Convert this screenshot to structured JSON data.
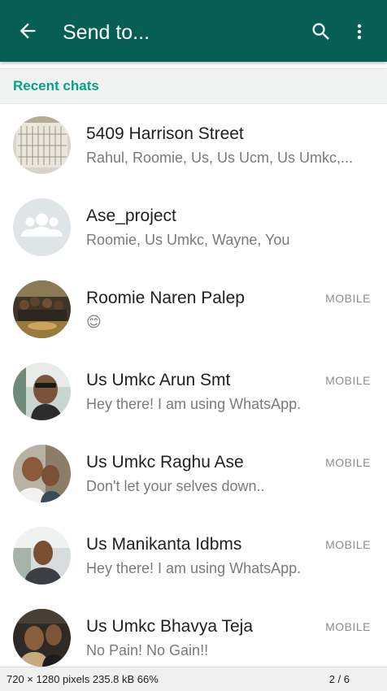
{
  "appbar": {
    "title": "Send to...",
    "color": "#075e54"
  },
  "section": {
    "label": "Recent chats",
    "color": "#07a187"
  },
  "chats": [
    {
      "name": "5409 Harrison Street",
      "subtitle": "Rahul, Roomie, Us, Us Ucm, Us Umkc,...",
      "tag": ""
    },
    {
      "name": "Ase_project",
      "subtitle": "Roomie, Us Umkc, Wayne, You",
      "tag": ""
    },
    {
      "name": "Roomie Naren Palep",
      "subtitle": "😊",
      "tag": "MOBILE"
    },
    {
      "name": "Us Umkc Arun Smt",
      "subtitle": "Hey there! I am using WhatsApp.",
      "tag": "MOBILE"
    },
    {
      "name": "Us Umkc Raghu Ase",
      "subtitle": "Don't let your selves down..",
      "tag": "MOBILE"
    },
    {
      "name": "Us Manikanta Idbms",
      "subtitle": "Hey there! I am using WhatsApp.",
      "tag": "MOBILE"
    },
    {
      "name": "Us Umkc Bhavya Teja",
      "subtitle": "No Pain! No Gain!!",
      "tag": "MOBILE"
    }
  ],
  "viewer_status": {
    "info": "720 × 1280 pixels  235.8 kB   66%",
    "page": "2 / 6"
  },
  "icons": {
    "back": "arrow-back-icon",
    "search": "search-icon",
    "more": "more-vert-icon",
    "group": "group-icon"
  }
}
